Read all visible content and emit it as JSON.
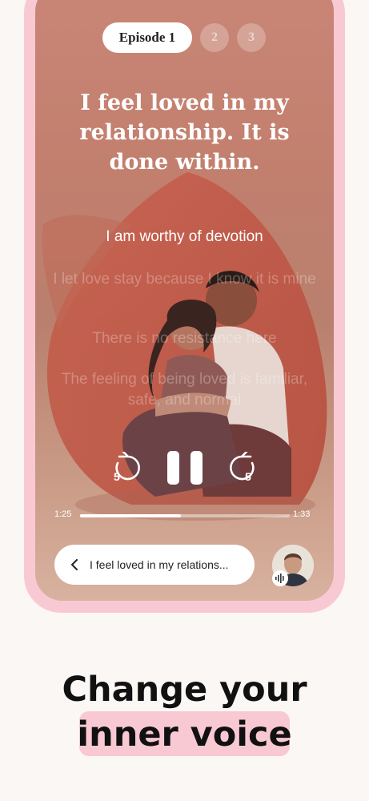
{
  "episodes": {
    "active_label": "Episode 1",
    "others": [
      "2",
      "3"
    ]
  },
  "affirmation": "I feel loved in my relationship. It is done within.",
  "lines": {
    "active": "I am worthy of devotion",
    "upcoming": [
      "I let love stay because I know it is mine",
      "There is no resistance here",
      "The feeling of being loved is familiar, safe, and normal"
    ]
  },
  "player": {
    "skip_back_seconds": "5",
    "skip_forward_seconds": "5",
    "current_time": "1:25",
    "total_time": "1:33",
    "progress": 0.48
  },
  "session_pill_text": "I feel loved in my relations...",
  "marketing": {
    "line1": "Change your",
    "line2": "inner voice"
  },
  "colors": {
    "frame_pink": "#f9c9d3",
    "screen_terracotta": "#c27f6e",
    "highlight_pink": "#f9c9d3"
  },
  "icons": [
    "chevron-left-icon",
    "replay-5-icon",
    "forward-5-icon",
    "pause-icon",
    "voice-waveform-icon"
  ]
}
